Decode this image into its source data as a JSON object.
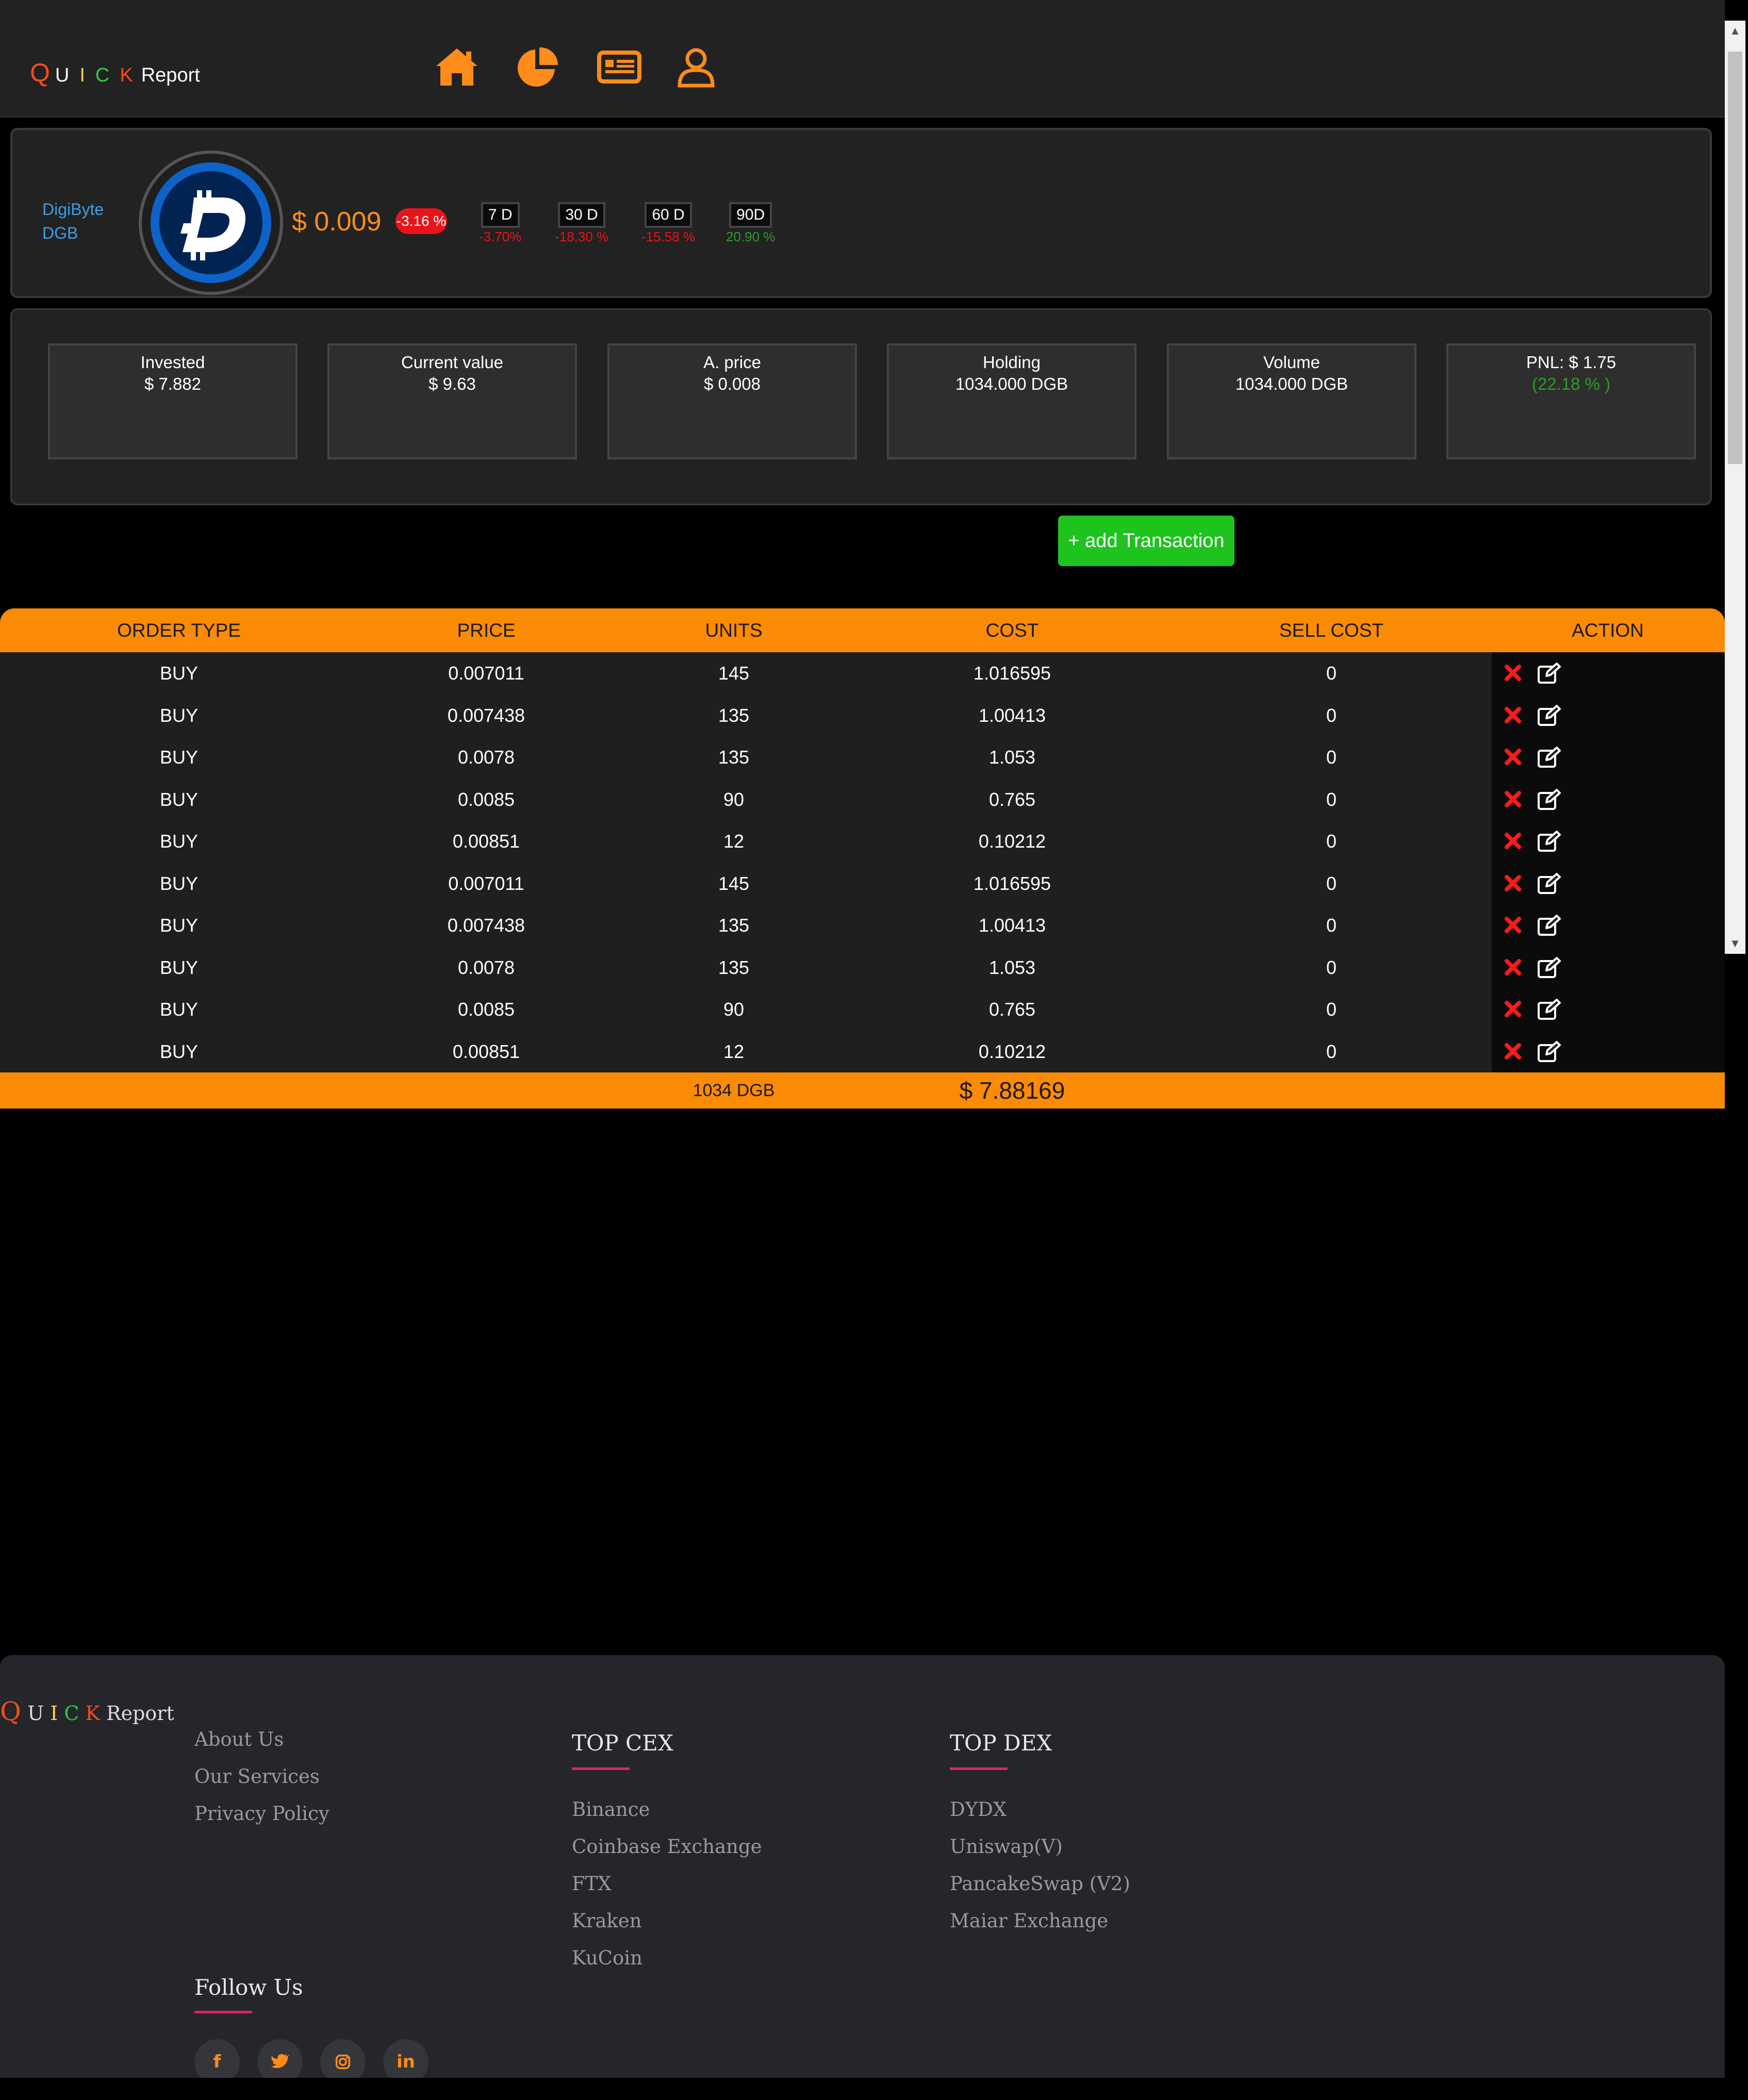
{
  "header": {
    "logo": {
      "q": "Q",
      "u": "U",
      "i": "I",
      "c": "C",
      "k": "K",
      "report": "Report"
    },
    "nav_icons": [
      "home-icon",
      "pie-chart-icon",
      "news-icon",
      "user-icon"
    ],
    "accent_color": "#ff8c1a"
  },
  "coin": {
    "name": "DigiByte",
    "symbol": "DGB",
    "price": "$ 0.009",
    "change_24h": "-3.16 %",
    "periods": [
      {
        "label": "7 D",
        "change": "-3.70%",
        "color": "#e8141a"
      },
      {
        "label": "30 D",
        "change": "-18.30 %",
        "color": "#e8141a"
      },
      {
        "label": "60 D",
        "change": "-15.58 %",
        "color": "#e8141a"
      },
      {
        "label": "90D",
        "change": "20.90 %",
        "color": "#2a9d2a"
      }
    ]
  },
  "stats": [
    {
      "title": "Invested",
      "value": "$ 7.882"
    },
    {
      "title": "Current value",
      "value": "$ 9.63"
    },
    {
      "title": "A. price",
      "value": "$ 0.008"
    },
    {
      "title": "Holding",
      "value": "1034.000 DGB"
    },
    {
      "title": "Volume",
      "value": "1034.000 DGB"
    },
    {
      "title": "PNL: $ 1.75",
      "value": "(22.18 % )"
    }
  ],
  "add_button": "+ add Transaction",
  "table": {
    "headers": [
      "ORDER TYPE",
      "PRICE",
      "UNITS",
      "COST",
      "SELL COST",
      "ACTION"
    ],
    "rows": [
      [
        "BUY",
        "0.007011",
        "145",
        "1.016595",
        "0"
      ],
      [
        "BUY",
        "0.007438",
        "135",
        "1.00413",
        "0"
      ],
      [
        "BUY",
        "0.0078",
        "135",
        "1.053",
        "0"
      ],
      [
        "BUY",
        "0.0085",
        "90",
        "0.765",
        "0"
      ],
      [
        "BUY",
        "0.00851",
        "12",
        "0.10212",
        "0"
      ],
      [
        "BUY",
        "0.007011",
        "145",
        "1.016595",
        "0"
      ],
      [
        "BUY",
        "0.007438",
        "135",
        "1.00413",
        "0"
      ],
      [
        "BUY",
        "0.0078",
        "135",
        "1.053",
        "0"
      ],
      [
        "BUY",
        "0.0085",
        "90",
        "0.765",
        "0"
      ],
      [
        "BUY",
        "0.00851",
        "12",
        "0.10212",
        "0"
      ]
    ],
    "footer": {
      "units_total": "1034 DGB",
      "cost_total": "$ 7.88169"
    }
  },
  "footer": {
    "logo": {
      "q": "Q",
      "u": "U",
      "i": "I",
      "c": "C",
      "k": "K",
      "report": "Report"
    },
    "links": [
      "About Us",
      "Our Services",
      "Privacy Policy"
    ],
    "top_cex": {
      "title": "TOP CEX",
      "items": [
        "Binance",
        "Coinbase Exchange",
        "FTX",
        "Kraken",
        "KuCoin"
      ]
    },
    "top_dex": {
      "title": "TOP DEX",
      "items": [
        "DYDX",
        "Uniswap(V)",
        "PancakeSwap (V2)",
        "Maiar Exchange"
      ]
    },
    "follow": {
      "title": "Follow Us",
      "icons": [
        "facebook-icon",
        "twitter-icon",
        "instagram-icon",
        "linkedin-icon"
      ]
    }
  }
}
